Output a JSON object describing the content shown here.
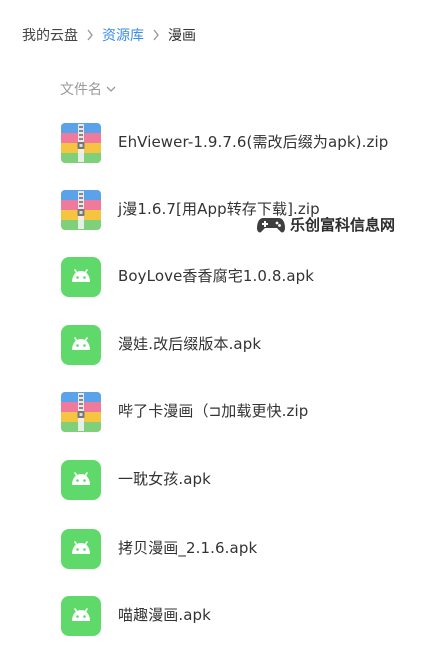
{
  "breadcrumb": {
    "items": [
      "我的云盘",
      "资源库",
      "漫画"
    ]
  },
  "list": {
    "header_label": "文件名"
  },
  "files": [
    {
      "name": "EhViewer-1.9.7.6(需改后缀为apk).zip",
      "type": "zip-icon"
    },
    {
      "name": "j漫1.6.7[用App转存下载].zip",
      "type": "zip-icon"
    },
    {
      "name": "BoyLove香香腐宅1.0.8.apk",
      "type": "apk-icon"
    },
    {
      "name": "漫娃.改后缀版本.apk",
      "type": "apk-icon"
    },
    {
      "name": "哔了卡漫画（⊐加载更快.zip",
      "type": "zip-icon"
    },
    {
      "name": "一耽女孩.apk",
      "type": "apk-icon"
    },
    {
      "name": "拷贝漫画_2.1.6.apk",
      "type": "apk-icon"
    },
    {
      "name": "喵趣漫画.apk",
      "type": "apk-icon"
    }
  ],
  "watermark": {
    "text": "乐创富科信息网"
  },
  "colors": {
    "link": "#3a8ee6",
    "apk_green": "#5fd96a",
    "zip_stripes": [
      "#5aa2ea",
      "#f07a9c",
      "#f5c542",
      "#7ed07a"
    ]
  }
}
